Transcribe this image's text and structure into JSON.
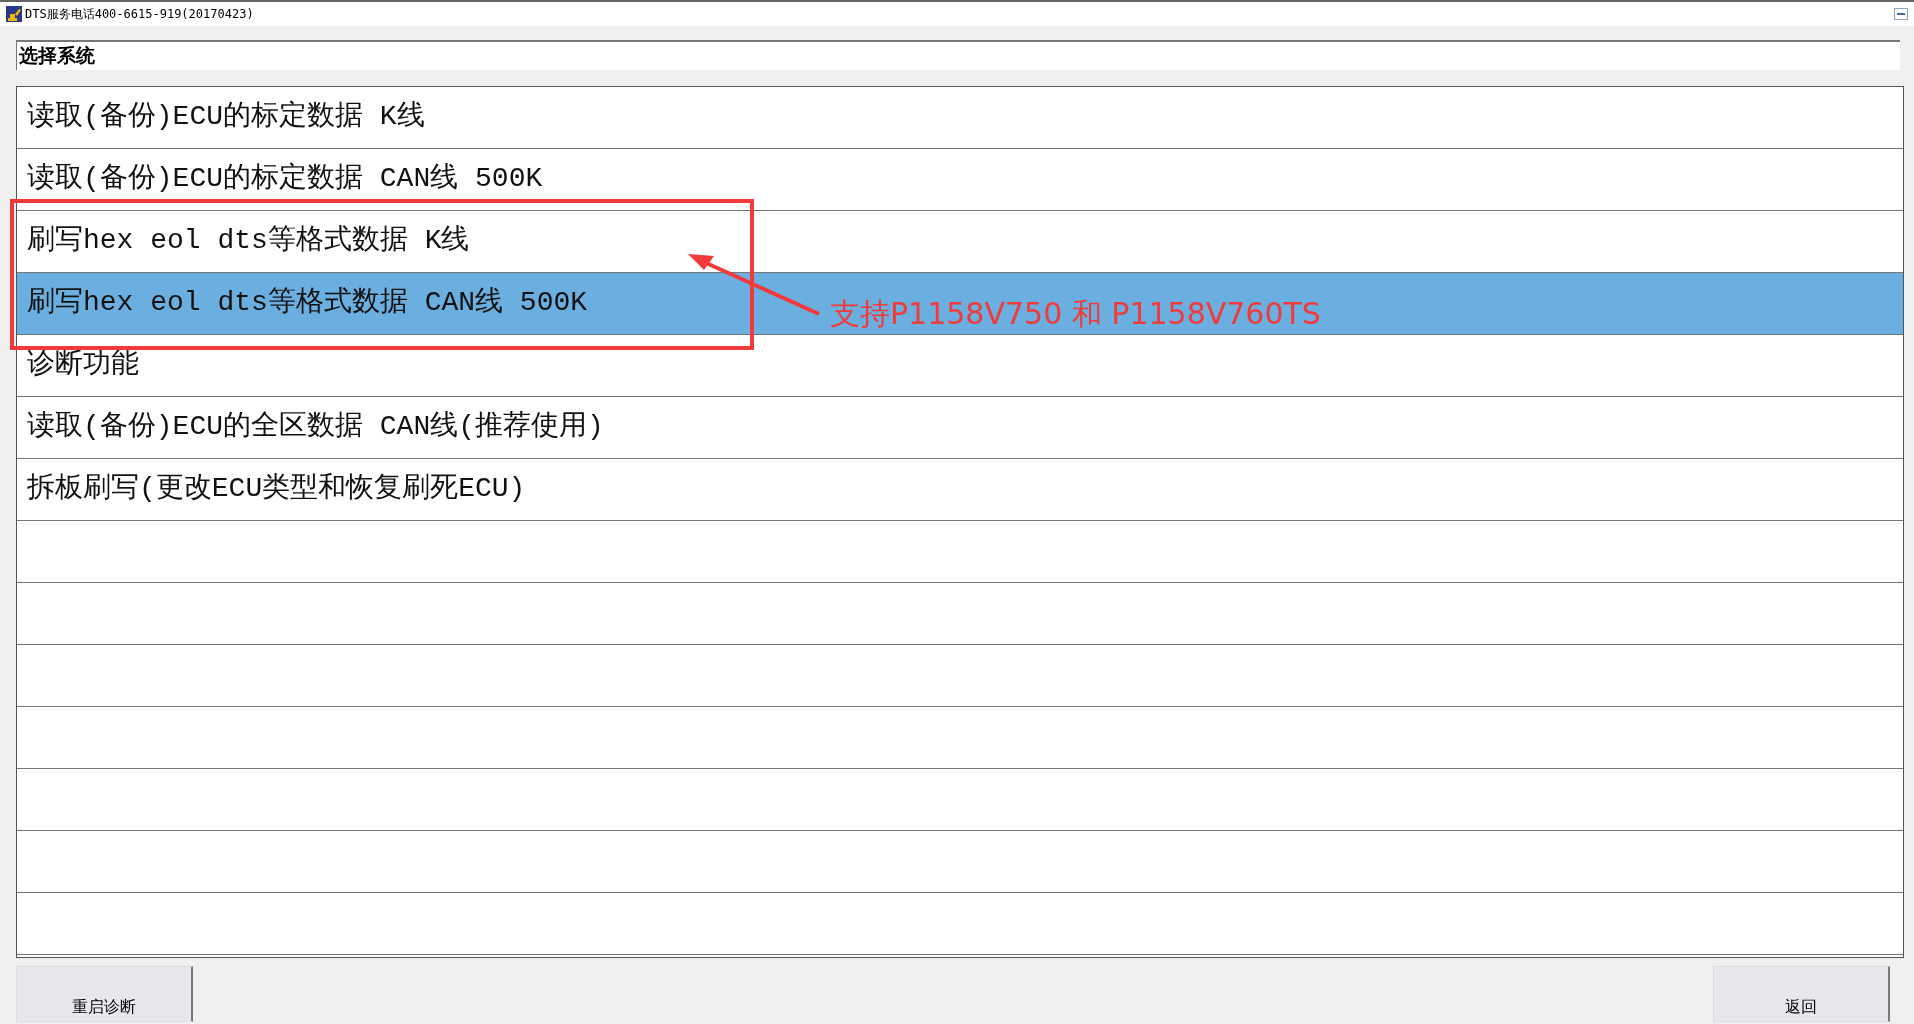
{
  "window": {
    "title": "DTS服务电话400-6615-919(20170423)"
  },
  "header": {
    "label": "选择系统"
  },
  "menu": [
    {
      "label": "读取(备份)ECU的标定数据 K线",
      "selected": false
    },
    {
      "label": "读取(备份)ECU的标定数据 CAN线 500K",
      "selected": false
    },
    {
      "label": "刷写hex eol dts等格式数据 K线",
      "selected": false
    },
    {
      "label": "刷写hex eol dts等格式数据 CAN线 500K",
      "selected": true
    },
    {
      "label": "诊断功能",
      "selected": false
    },
    {
      "label": "读取(备份)ECU的全区数据 CAN线(推荐使用)",
      "selected": false
    },
    {
      "label": "拆板刷写(更改ECU类型和恢复刷死ECU)",
      "selected": false
    }
  ],
  "annotation": {
    "text": "支持P1158V750 和 P1158V760TS"
  },
  "buttons": [
    {
      "label": "重启诊断"
    },
    {
      "label": "返回"
    }
  ]
}
